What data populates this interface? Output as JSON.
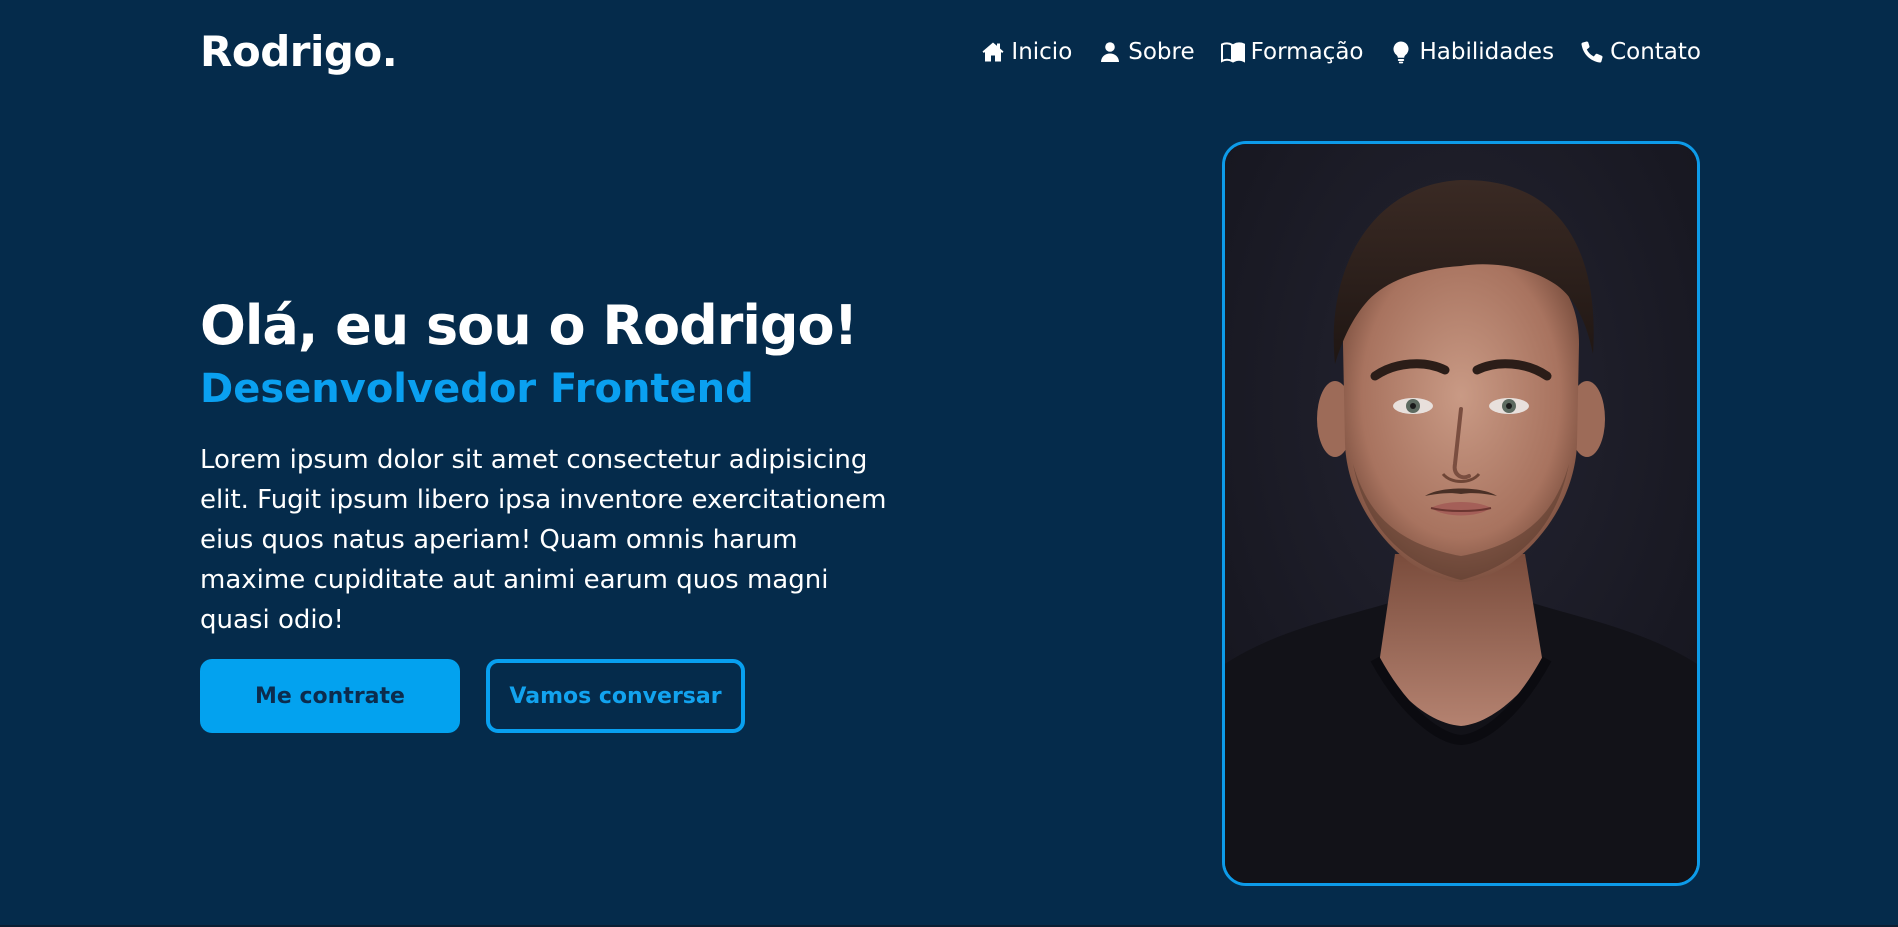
{
  "header": {
    "logo": "Rodrigo.",
    "nav": [
      {
        "label": "Inicio",
        "icon": "home-icon"
      },
      {
        "label": "Sobre",
        "icon": "user-icon"
      },
      {
        "label": "Formação",
        "icon": "book-icon"
      },
      {
        "label": "Habilidades",
        "icon": "lightbulb-icon"
      },
      {
        "label": "Contato",
        "icon": "phone-icon"
      }
    ]
  },
  "hero": {
    "title": "Olá, eu sou o Rodrigo!",
    "subtitle": "Desenvolvedor Frontend",
    "description": "Lorem ipsum dolor sit amet consectetur adipisicing elit. Fugit ipsum libero ipsa inventore exercitationem eius quos natus aperiam! Quam omnis harum maxime cupiditate aut animi earum quos magni quasi odio!",
    "primary_button": "Me contrate",
    "secondary_button": "Vamos conversar"
  },
  "portrait": {
    "subject": "portrait-photo"
  },
  "colors": {
    "background": "#052b4b",
    "accent": "#03a2ef",
    "text": "#ffffff"
  }
}
